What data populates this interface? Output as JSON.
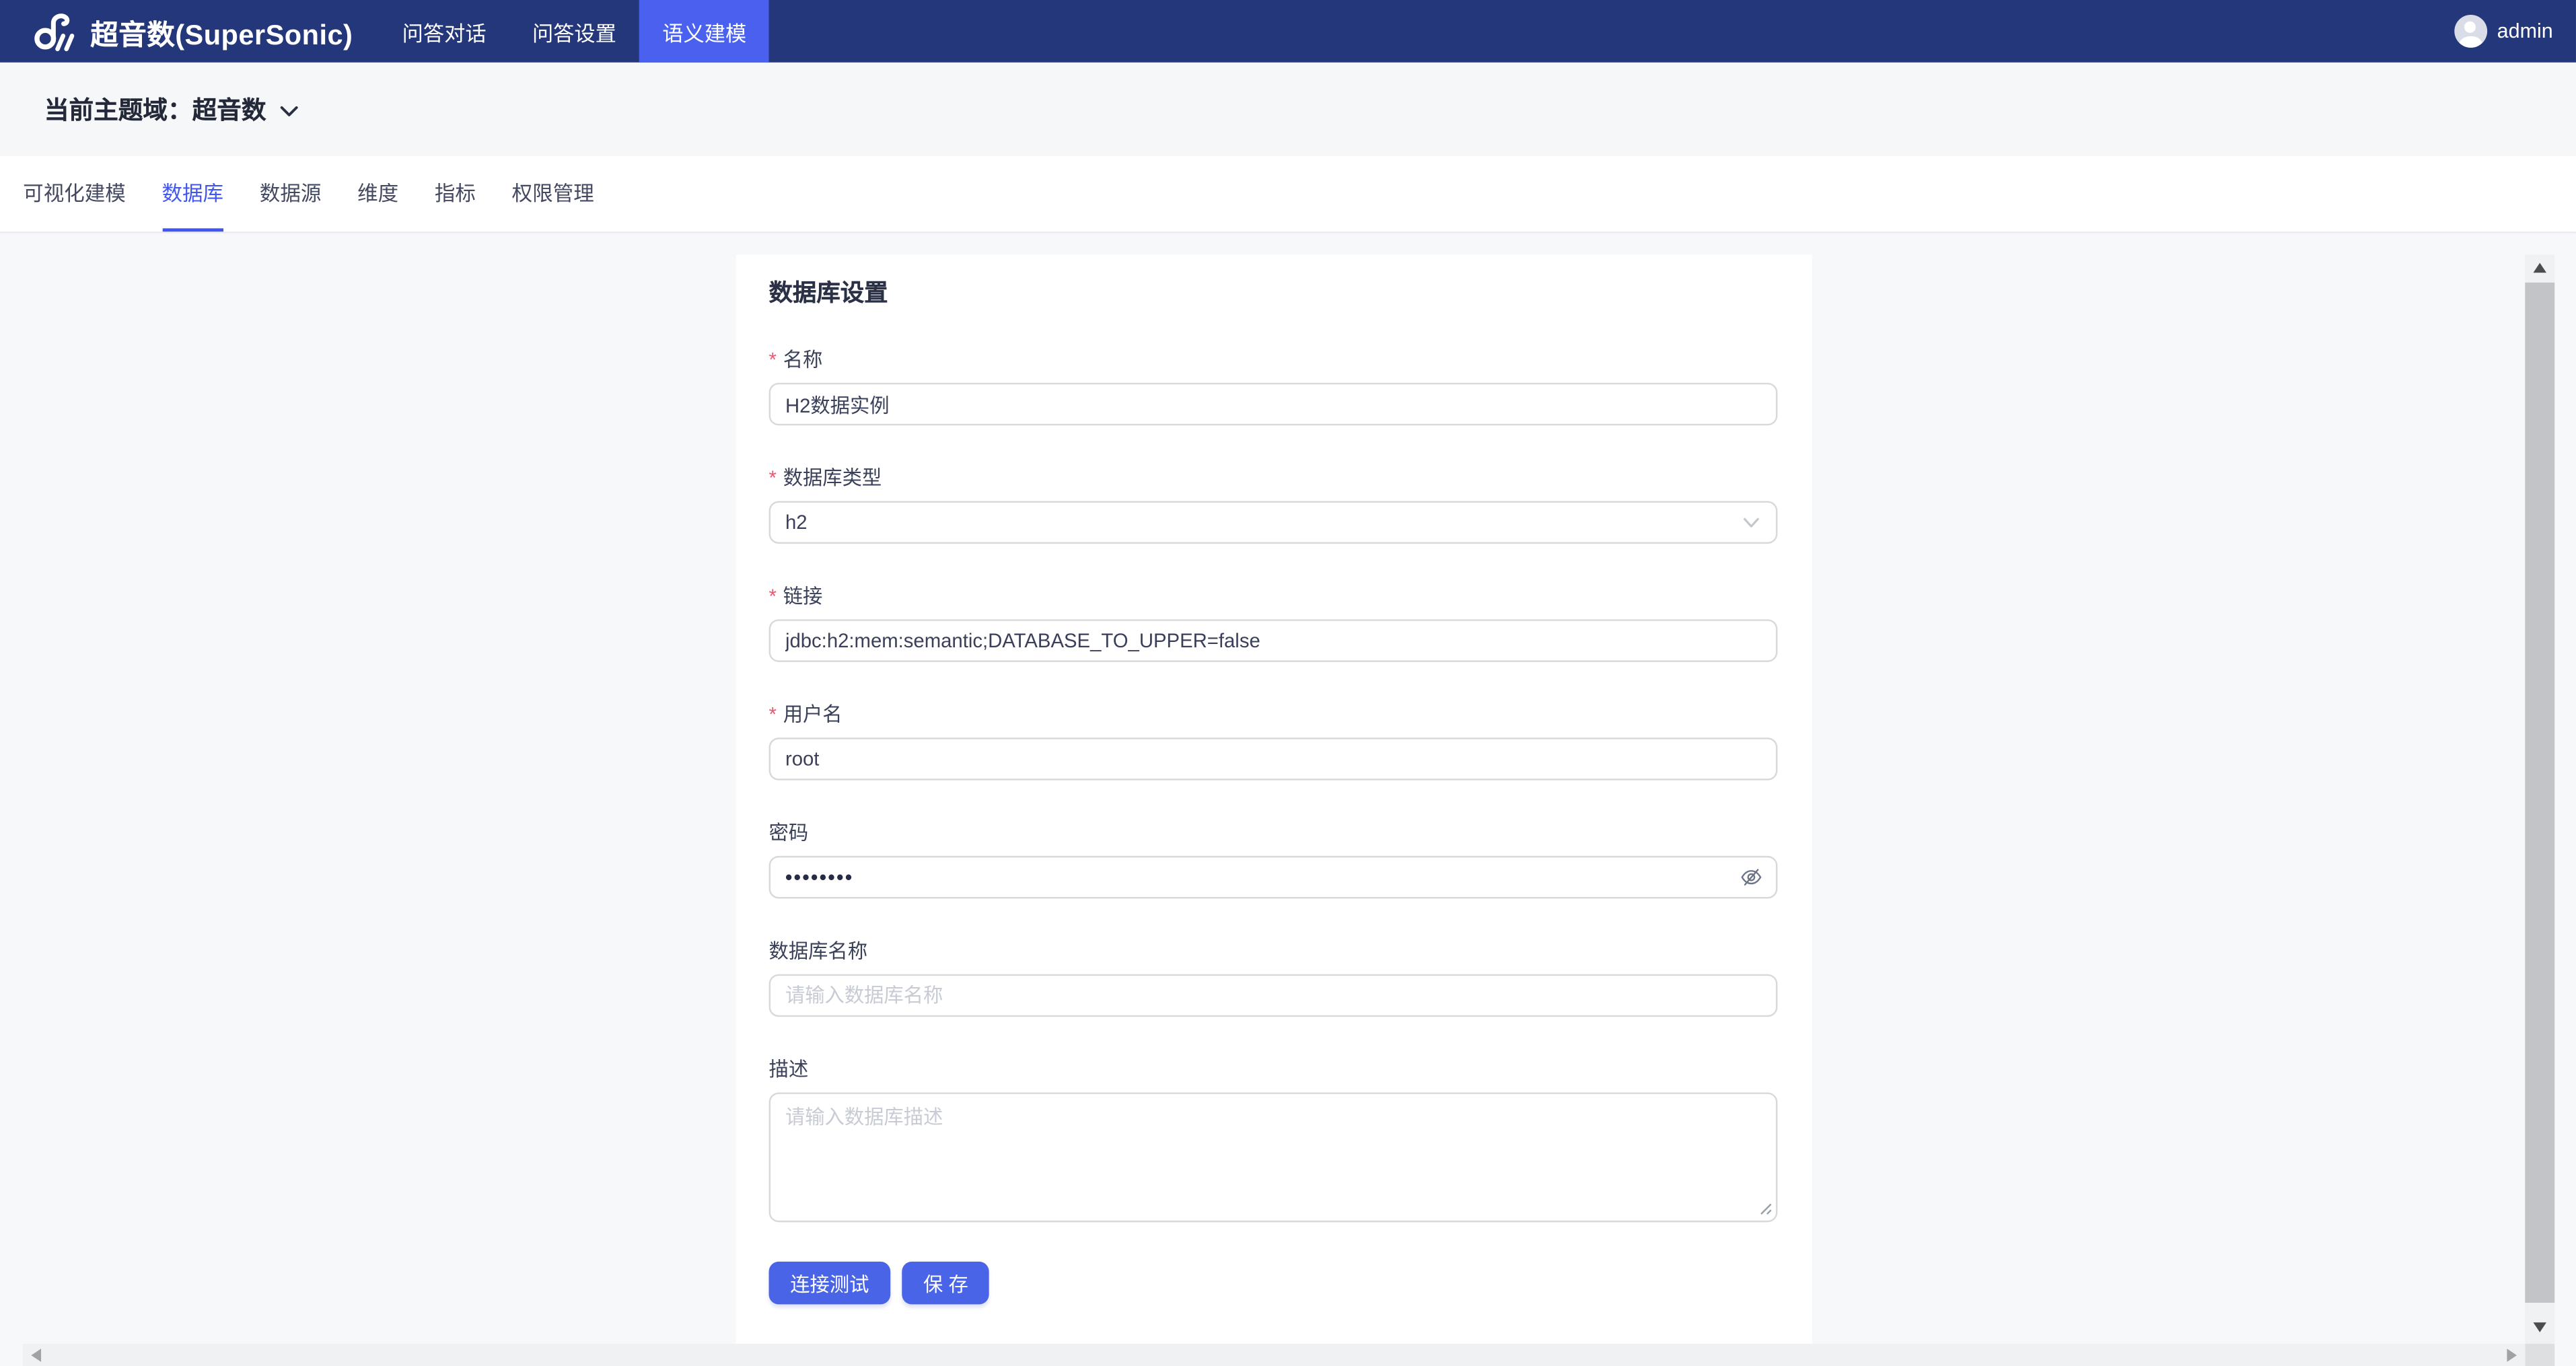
{
  "topbar": {
    "brand": "超音数(SuperSonic)",
    "nav_items": [
      {
        "label": "问答对话"
      },
      {
        "label": "问答设置"
      },
      {
        "label": "语义建模"
      }
    ],
    "username": "admin"
  },
  "domain_bar": {
    "label": "当前主题域：超音数"
  },
  "tabs": [
    {
      "label": "可视化建模"
    },
    {
      "label": "数据库"
    },
    {
      "label": "数据源"
    },
    {
      "label": "维度"
    },
    {
      "label": "指标"
    },
    {
      "label": "权限管理"
    }
  ],
  "form": {
    "title": "数据库设置",
    "required_mark": "*",
    "fields": {
      "name": {
        "label": "名称",
        "value": "H2数据实例"
      },
      "db_type": {
        "label": "数据库类型",
        "value": "h2"
      },
      "url": {
        "label": "链接",
        "value": "jdbc:h2:mem:semantic;DATABASE_TO_UPPER=false"
      },
      "username": {
        "label": "用户名",
        "value": "root"
      },
      "password": {
        "label": "密码",
        "masked_value": "••••••••"
      },
      "database": {
        "label": "数据库名称",
        "placeholder": "请输入数据库名称"
      },
      "description": {
        "label": "描述",
        "placeholder": "请输入数据库描述"
      }
    },
    "buttons": {
      "test": "连接测试",
      "save": "保 存"
    }
  },
  "colors": {
    "topbar_bg": "#24377a",
    "nav_active_bg": "#4a61f0",
    "tab_active": "#4056ee",
    "primary_button": "#4a64e8",
    "required_mark": "#e9596f",
    "page_bg": "#f7f8fa"
  }
}
